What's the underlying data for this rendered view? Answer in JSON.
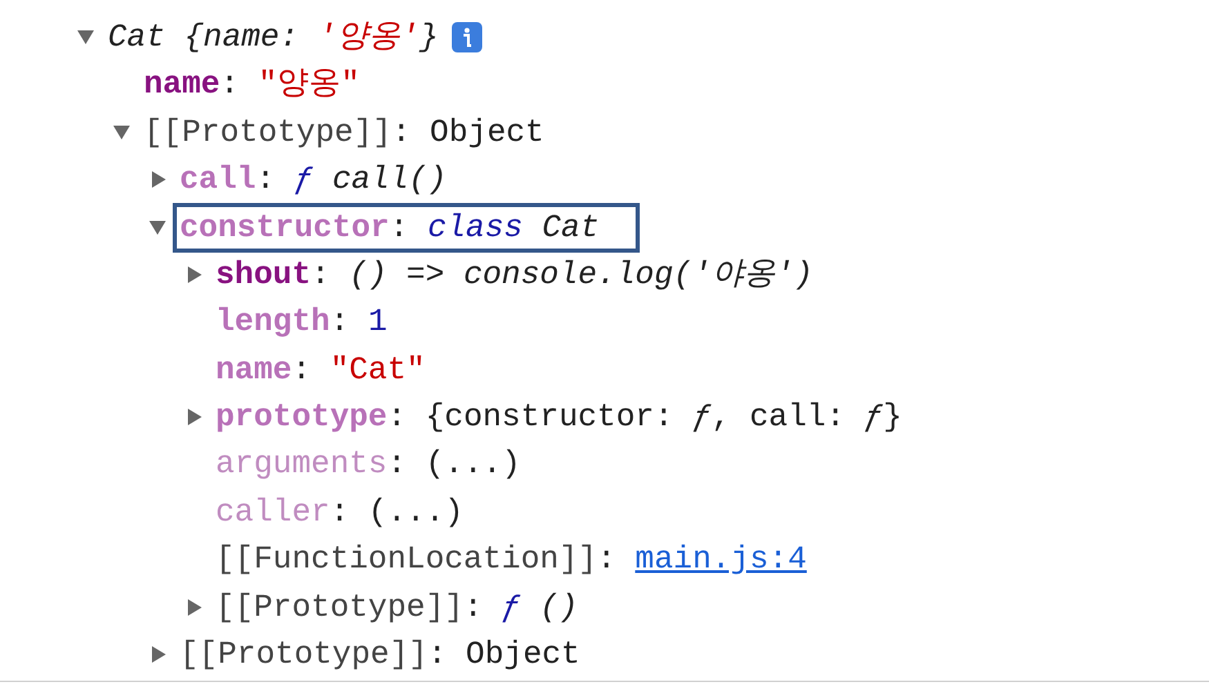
{
  "tree": [
    {
      "expanded": true,
      "info_badge": true,
      "value": [
        {
          "text": "Cat {name: ",
          "kind": "text",
          "italic": true
        },
        {
          "text": "'양옹'",
          "kind": "string",
          "italic": true
        },
        {
          "text": "}",
          "kind": "text",
          "italic": true
        }
      ],
      "children": [
        {
          "key": "name",
          "kind": "own",
          "value": [
            {
              "text": ": ",
              "kind": "text"
            },
            {
              "text": "\"양옹\"",
              "kind": "string"
            }
          ]
        },
        {
          "key": "[[Prototype]]",
          "kind": "internal",
          "expanded": true,
          "value": [
            {
              "text": ": Object",
              "kind": "text"
            }
          ],
          "children": [
            {
              "key": "call",
              "kind": "nonenumerable",
              "expanded": false,
              "value": [
                {
                  "text": ": ",
                  "kind": "text"
                },
                {
                  "text": "ƒ",
                  "kind": "keyword",
                  "italic": true
                },
                {
                  "text": " call()",
                  "kind": "text",
                  "italic": true
                }
              ]
            },
            {
              "key": "constructor",
              "kind": "nonenumerable",
              "expanded": true,
              "highlighted": true,
              "value": [
                {
                  "text": ": ",
                  "kind": "text"
                },
                {
                  "text": "class",
                  "kind": "keyword",
                  "italic": true
                },
                {
                  "text": " Cat",
                  "kind": "text",
                  "italic": true
                }
              ],
              "children": [
                {
                  "key": "shout",
                  "kind": "own",
                  "expanded": false,
                  "value": [
                    {
                      "text": ": ",
                      "kind": "text"
                    },
                    {
                      "text": "() => console.log('야옹')",
                      "kind": "text",
                      "italic": true
                    }
                  ]
                },
                {
                  "key": "length",
                  "kind": "nonenumerable",
                  "value": [
                    {
                      "text": ": ",
                      "kind": "text"
                    },
                    {
                      "text": "1",
                      "kind": "number"
                    }
                  ]
                },
                {
                  "key": "name",
                  "kind": "nonenumerable",
                  "value": [
                    {
                      "text": ": ",
                      "kind": "text"
                    },
                    {
                      "text": "\"Cat\"",
                      "kind": "string"
                    }
                  ]
                },
                {
                  "key": "prototype",
                  "kind": "nonenumerable",
                  "expanded": false,
                  "value": [
                    {
                      "text": ": {constructor: ",
                      "kind": "text"
                    },
                    {
                      "text": "ƒ",
                      "kind": "text",
                      "italic": true
                    },
                    {
                      "text": ", call: ",
                      "kind": "text"
                    },
                    {
                      "text": "ƒ",
                      "kind": "text",
                      "italic": true
                    },
                    {
                      "text": "}",
                      "kind": "text"
                    }
                  ]
                },
                {
                  "key": "arguments",
                  "kind": "accessor",
                  "value": [
                    {
                      "text": ": (...)",
                      "kind": "text"
                    }
                  ]
                },
                {
                  "key": "caller",
                  "kind": "accessor",
                  "value": [
                    {
                      "text": ": (...)",
                      "kind": "text"
                    }
                  ]
                },
                {
                  "key": "[[FunctionLocation]]",
                  "kind": "internal",
                  "value": [
                    {
                      "text": ": ",
                      "kind": "text"
                    },
                    {
                      "text": "main.js:4",
                      "kind": "link"
                    }
                  ]
                },
                {
                  "key": "[[Prototype]]",
                  "kind": "internal",
                  "expanded": false,
                  "value": [
                    {
                      "text": ": ",
                      "kind": "text"
                    },
                    {
                      "text": "ƒ",
                      "kind": "keyword",
                      "italic": true
                    },
                    {
                      "text": " ()",
                      "kind": "text",
                      "italic": true
                    }
                  ]
                }
              ]
            },
            {
              "key": "[[Prototype]]",
              "kind": "internal",
              "expanded": false,
              "value": [
                {
                  "text": ": Object",
                  "kind": "text"
                }
              ]
            }
          ]
        }
      ]
    }
  ]
}
